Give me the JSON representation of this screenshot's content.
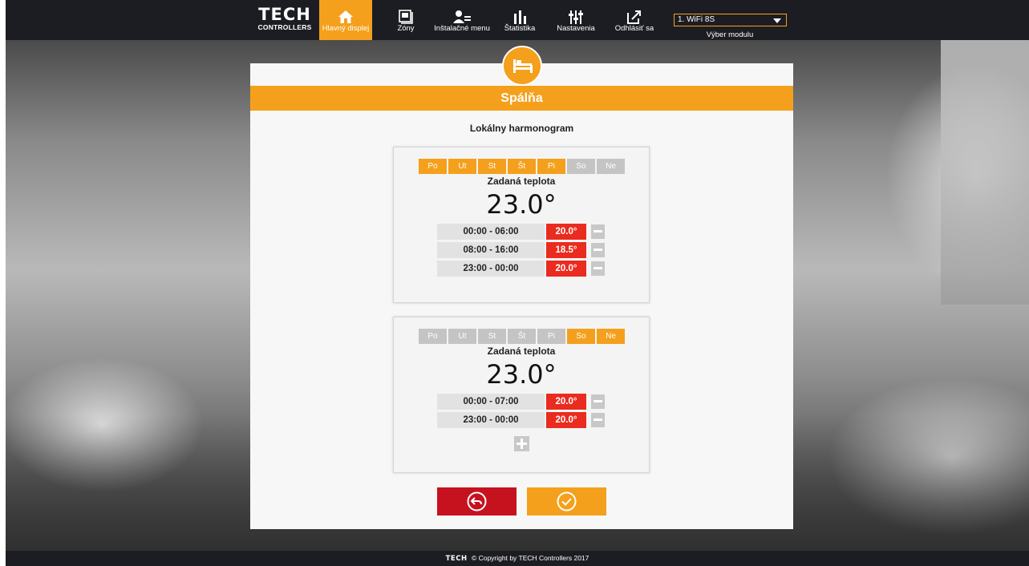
{
  "brand": {
    "logo_mark": "TECH",
    "logo_sub": "CONTROLLERS"
  },
  "nav": {
    "items": [
      {
        "label": "Hlavný displej",
        "icon": "home-icon",
        "active": true
      },
      {
        "label": "Zóny",
        "icon": "zones-icon",
        "active": false
      },
      {
        "label": "Inštalačné menu",
        "icon": "installer-icon",
        "active": false
      },
      {
        "label": "Štatistika",
        "icon": "statistics-icon",
        "active": false
      },
      {
        "label": "Nastavenia",
        "icon": "settings-sliders-icon",
        "active": false
      },
      {
        "label": "Odhlásiť sa",
        "icon": "logout-icon",
        "active": false
      }
    ],
    "module_select": {
      "value": "1. WiFi 8S",
      "caption": "Výber modulu"
    }
  },
  "room": {
    "name": "Spálňa",
    "icon": "bed-icon"
  },
  "schedule_title": "Lokálny harmonogram",
  "days": [
    "Po",
    "Ut",
    "St",
    "Št",
    "Pi",
    "So",
    "Ne"
  ],
  "schedules": [
    {
      "active_days": [
        true,
        true,
        true,
        true,
        true,
        false,
        false
      ],
      "target_label": "Zadaná teplota",
      "target_value": "23.0°",
      "intervals": [
        {
          "range": "00:00  -  06:00",
          "temp": "20.0°"
        },
        {
          "range": "08:00  -  16:00",
          "temp": "18.5°"
        },
        {
          "range": "23:00  -  00:00",
          "temp": "20.0°"
        }
      ]
    },
    {
      "active_days": [
        false,
        false,
        false,
        false,
        false,
        true,
        true
      ],
      "target_label": "Zadaná teplota",
      "target_value": "23.0°",
      "intervals": [
        {
          "range": "00:00  -  07:00",
          "temp": "20.0°"
        },
        {
          "range": "23:00  -  00:00",
          "temp": "20.0°"
        }
      ]
    }
  ],
  "buttons": {
    "back_icon": "back-arrow-icon",
    "confirm_icon": "check-icon"
  },
  "footer": {
    "mark": "TECH",
    "text": "© Copyright by TECH Controllers 2017"
  },
  "colors": {
    "accent": "#f4a01c",
    "temp_red": "#ea2b1f",
    "back_red": "#c6121f",
    "bar": "#1c1d22"
  }
}
